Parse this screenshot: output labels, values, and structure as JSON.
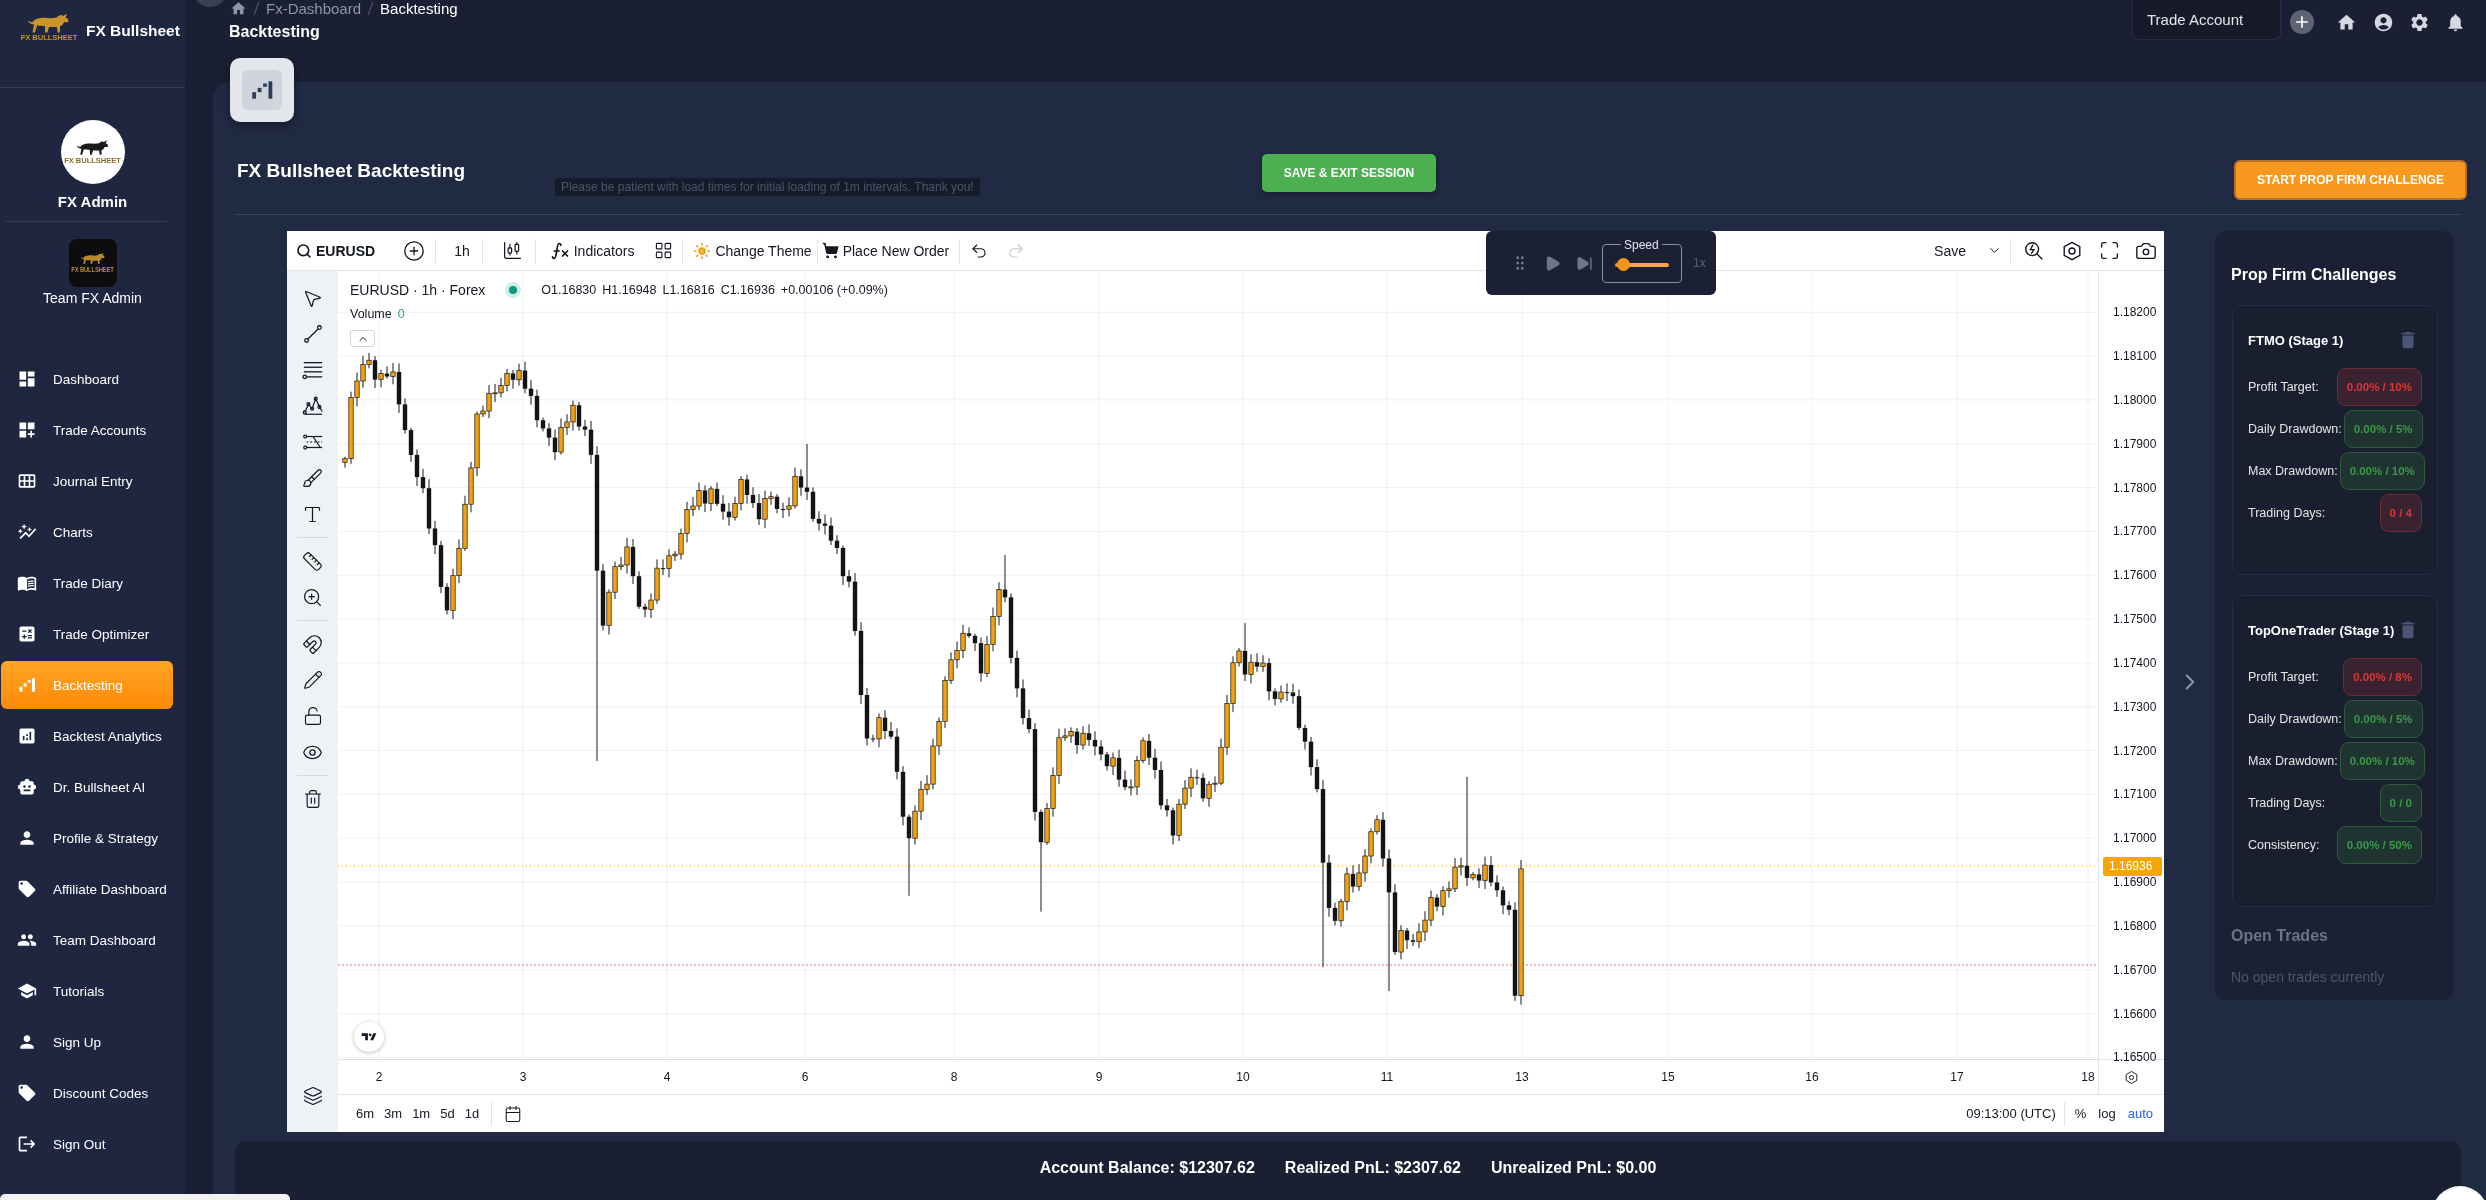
{
  "sidebar": {
    "brand": {
      "logo_text": "FX BULLSHEET",
      "name": "FX Bullsheet"
    },
    "profile": {
      "logo_text": "FX BULLSHEET",
      "name": "FX Admin"
    },
    "team": {
      "logo_text": "FX BULLSHEET",
      "name": "Team FX Admin"
    },
    "items": [
      {
        "label": "Dashboard",
        "selected": false
      },
      {
        "label": "Trade Accounts",
        "selected": false
      },
      {
        "label": "Journal Entry",
        "selected": false
      },
      {
        "label": "Charts",
        "selected": false
      },
      {
        "label": "Trade Diary",
        "selected": false
      },
      {
        "label": "Trade Optimizer",
        "selected": false
      },
      {
        "label": "Backtesting",
        "selected": true
      },
      {
        "label": "Backtest Analytics",
        "selected": false
      },
      {
        "label": "Dr. Bullsheet AI",
        "selected": false
      },
      {
        "label": "Profile & Strategy",
        "selected": false
      },
      {
        "label": "Affiliate Dashboard",
        "selected": false
      },
      {
        "label": "Team Dashboard",
        "selected": false
      },
      {
        "label": "Tutorials",
        "selected": false
      },
      {
        "label": "Sign Up",
        "selected": false
      },
      {
        "label": "Discount Codes",
        "selected": false
      },
      {
        "label": "Sign Out",
        "selected": false
      }
    ]
  },
  "header": {
    "breadcrumb": [
      {
        "label": "Fx-Dashboard",
        "current": false
      },
      {
        "label": "Backtesting",
        "current": true
      }
    ],
    "title": "Backtesting",
    "account_select": {
      "value": "Trade Account"
    }
  },
  "page": {
    "title": "FX Bullsheet Backtesting",
    "notice": "Please be patient with load times for initial loading of 1m intervals. Thank you!",
    "save_button": "SAVE & EXIT SESSION",
    "challenge_button": "START PROP FIRM CHALLENGE"
  },
  "chart": {
    "toolbar": {
      "symbol": "EURUSD",
      "interval": "1h",
      "indicators": "Indicators",
      "theme": "Change Theme",
      "order": "Place New Order",
      "undo": {
        "disabled": false
      },
      "redo": {
        "disabled": true
      },
      "save": "Save"
    },
    "replay": {
      "speed_label": "Speed",
      "level": 0.15,
      "speed": "1x"
    },
    "legend": {
      "title": "EURUSD · 1h · Forex",
      "market_open": true,
      "values": [
        "O1.16830",
        "H1.16948",
        "L1.16816",
        "C1.16936",
        "+0.00106 (+0.09%)"
      ],
      "volume_label": "Volume",
      "volume": "0"
    },
    "price_ticks": [
      "1.18200",
      "1.18100",
      "1.18000",
      "1.17900",
      "1.17800",
      "1.17700",
      "1.17600",
      "1.17500",
      "1.17400",
      "1.17300",
      "1.17200",
      "1.17100",
      "1.17000",
      "1.16900",
      "1.16800",
      "1.16700",
      "1.16600",
      "1.16500"
    ],
    "current_price": "1.16936",
    "time_ticks": [
      "2",
      "3",
      "4",
      "6",
      "8",
      "9",
      "10",
      "11",
      "13",
      "15",
      "16",
      "17",
      "18"
    ],
    "ranges": [
      "6m",
      "3m",
      "1m",
      "5d",
      "1d"
    ],
    "clock": "09:13:00 (UTC)",
    "scale_options": [
      {
        "label": "%",
        "selected": false
      },
      {
        "label": "log",
        "selected": false
      },
      {
        "label": "auto",
        "selected": true
      }
    ]
  },
  "prop_firm": {
    "title": "Prop Firm Challenges",
    "challenges": [
      {
        "name": "FTMO (Stage 1)",
        "metrics": [
          {
            "label": "Profit Target:",
            "value": "0.00% / 10%",
            "passed": false
          },
          {
            "label": "Daily Drawdown:",
            "value": "0.00% / 5%",
            "passed": true
          },
          {
            "label": "Max Drawdown:",
            "value": "0.00% / 10%",
            "passed": true
          },
          {
            "label": "Trading Days:",
            "value": "0 / 4",
            "passed": false
          }
        ]
      },
      {
        "name": "TopOneTrader (Stage 1)",
        "metrics": [
          {
            "label": "Profit Target:",
            "value": "0.00% / 8%",
            "passed": false
          },
          {
            "label": "Daily Drawdown:",
            "value": "0.00% / 5%",
            "passed": true
          },
          {
            "label": "Max Drawdown:",
            "value": "0.00% / 10%",
            "passed": true
          },
          {
            "label": "Trading Days:",
            "value": "0 / 0",
            "passed": true
          },
          {
            "label": "Consistency:",
            "value": "0.00% / 50%",
            "passed": true
          }
        ]
      }
    ],
    "open_trades": {
      "title": "Open Trades",
      "empty_text": "No open trades currently"
    }
  },
  "account_summary": [
    "Account Balance: $12307.62",
    "Realized PnL: $2307.62",
    "Unrealized PnL: $0.00"
  ]
}
